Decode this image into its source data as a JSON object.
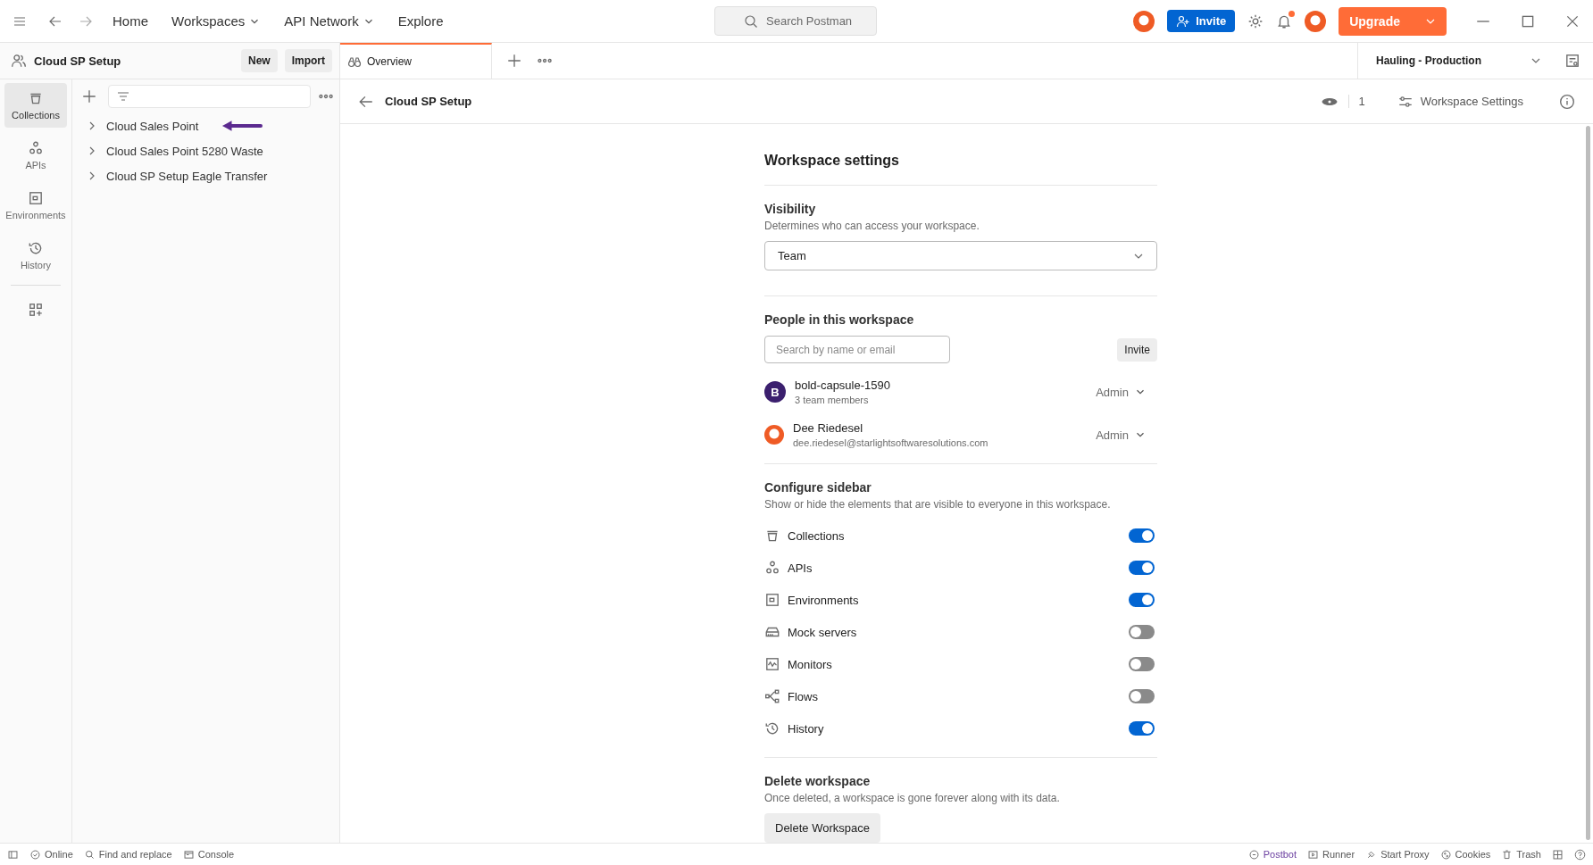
{
  "top_bar": {
    "nav": [
      {
        "label": "Home",
        "dropdown": false
      },
      {
        "label": "Workspaces",
        "dropdown": true
      },
      {
        "label": "API Network",
        "dropdown": true
      },
      {
        "label": "Explore",
        "dropdown": false
      }
    ],
    "search": {
      "placeholder": "Search Postman"
    },
    "invite": "Invite",
    "notifications_unread": true,
    "upgrade": "Upgrade"
  },
  "sidebar": {
    "workspace": "Cloud SP Setup",
    "new": "New",
    "import": "Import",
    "nav": [
      {
        "label": "Collections",
        "selected": true
      },
      {
        "label": "APIs",
        "selected": false
      },
      {
        "label": "Environments",
        "selected": false
      },
      {
        "label": "History",
        "selected": false
      }
    ],
    "collections": [
      {
        "name": "Cloud Sales Point",
        "pointer": true
      },
      {
        "name": "Cloud Sales Point 5280 Waste",
        "pointer": false
      },
      {
        "name": "Cloud SP Setup Eagle Transfer",
        "pointer": false
      }
    ]
  },
  "tabs": [
    {
      "label": "Overview",
      "selected": true
    }
  ],
  "environment": "Hauling - Production",
  "header": {
    "title": "Cloud SP Setup",
    "watchers": "1",
    "settings": "Workspace Settings"
  },
  "settings": {
    "title": "Workspace settings",
    "visibility": {
      "heading": "Visibility",
      "description": "Determines who can access your workspace.",
      "value": "Team"
    },
    "people": {
      "heading": "People in this workspace",
      "placeholder": "Search by name or email",
      "invite": "Invite",
      "members": [
        {
          "kind": "team",
          "initial": "B",
          "name": "bold-capsule-1590",
          "detail": "3 team members",
          "role": "Admin"
        },
        {
          "kind": "user",
          "name": "Dee Riedesel",
          "detail": "dee.riedesel@starlightsoftwaresolutions.com",
          "role": "Admin"
        }
      ]
    },
    "sidebar_config": {
      "heading": "Configure sidebar",
      "description": "Show or hide the elements that are visible to everyone in this workspace.",
      "items": [
        {
          "label": "Collections",
          "on": true
        },
        {
          "label": "APIs",
          "on": true
        },
        {
          "label": "Environments",
          "on": true
        },
        {
          "label": "Mock servers",
          "on": false
        },
        {
          "label": "Monitors",
          "on": false
        },
        {
          "label": "Flows",
          "on": false
        },
        {
          "label": "History",
          "on": true
        }
      ]
    },
    "delete": {
      "heading": "Delete workspace",
      "description": "Once deleted, a workspace is gone forever along with its data.",
      "button": "Delete Workspace"
    }
  },
  "status_bar": {
    "left": [
      "Online",
      "Find and replace",
      "Console"
    ],
    "right": [
      "Postbot",
      "Runner",
      "Start Proxy",
      "Cookies",
      "Trash"
    ]
  }
}
